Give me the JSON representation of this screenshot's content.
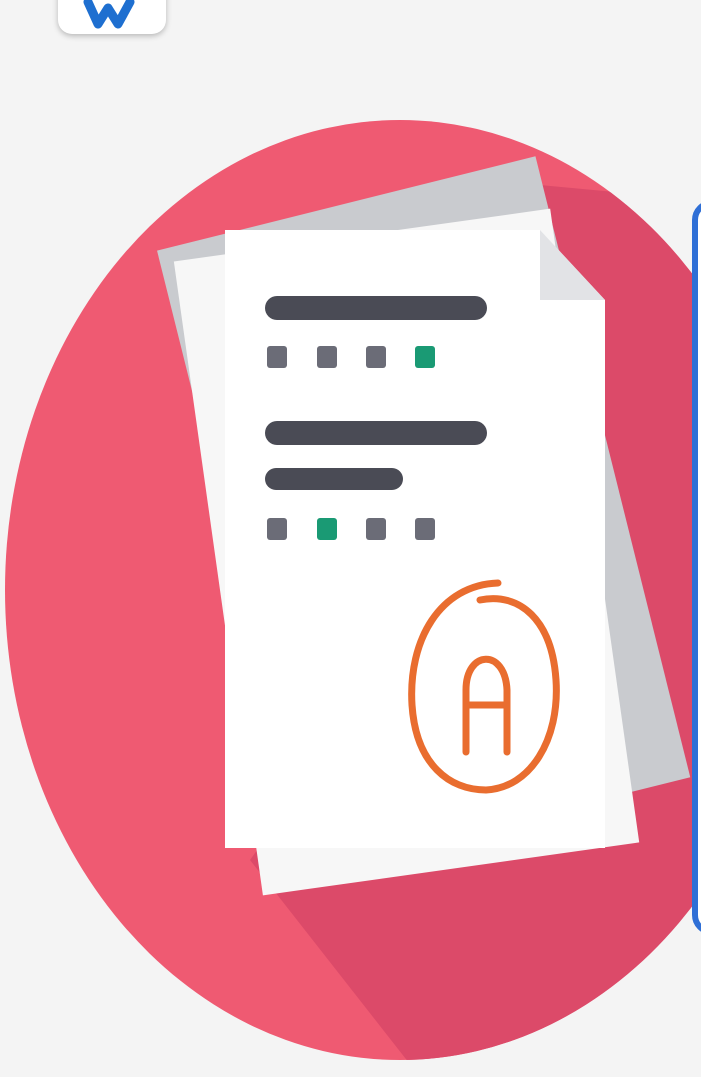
{
  "colors": {
    "background": "#f4f4f4",
    "circle": "#ef5a72",
    "circle_shadow": "#dc4a69",
    "paper": "#ffffff",
    "paper_back": "#c9cbcf",
    "line_dark": "#4a4b55",
    "square_gray": "#6b6c77",
    "square_green": "#1a9a74",
    "grade_orange": "#e96d2f",
    "panel_border": "#2f6fd6"
  },
  "icons": {
    "app_icon": "app-logo-icon",
    "document": "document-stack-icon",
    "grade": "grade-a-circle-icon"
  },
  "grade": {
    "letter": "A"
  }
}
